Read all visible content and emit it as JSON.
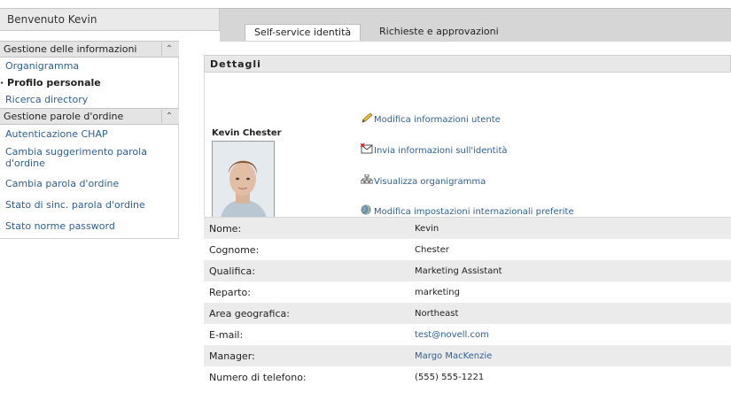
{
  "header": {
    "welcome": "Benvenuto Kevin",
    "tabs": [
      {
        "label": "Self-service identità",
        "active": true
      },
      {
        "label": "Richieste e approvazioni",
        "active": false
      }
    ]
  },
  "sidebar": {
    "groups": [
      {
        "title": "Gestione delle informazioni",
        "items": [
          {
            "label": "Organigramma"
          },
          {
            "label": "Profilo personale",
            "current": true
          },
          {
            "label": "Ricerca directory"
          }
        ]
      },
      {
        "title": "Gestione parole d'ordine",
        "items": [
          {
            "label": "Autenticazione CHAP"
          },
          {
            "label": "Cambia suggerimento parola d'ordine"
          },
          {
            "label": "Cambia parola d'ordine"
          },
          {
            "label": "Stato di sinc. parola d'ordine"
          },
          {
            "label": "Stato norme password"
          }
        ]
      }
    ]
  },
  "details": {
    "title": "Dettagli",
    "user_name": "Kevin Chester",
    "actions": [
      {
        "label": "Modifica informazioni utente",
        "icon": "pencil-icon"
      },
      {
        "label": "Invia informazioni sull'identità",
        "icon": "envelope-icon"
      },
      {
        "label": "Visualizza organigramma",
        "icon": "org-chart-icon"
      },
      {
        "label": "Modifica impostazioni internazionali preferite",
        "icon": "globe-icon"
      }
    ],
    "attributes": [
      {
        "label": "Nome:",
        "value": "Kevin",
        "link": false
      },
      {
        "label": "Cognome:",
        "value": "Chester",
        "link": false
      },
      {
        "label": "Qualifica:",
        "value": "Marketing Assistant",
        "link": false
      },
      {
        "label": "Reparto:",
        "value": "marketing",
        "link": false
      },
      {
        "label": "Area geografica:",
        "value": "Northeast",
        "link": false
      },
      {
        "label": "E-mail:",
        "value": "test@novell.com",
        "link": true
      },
      {
        "label": "Manager:",
        "value": "Margo MacKenzie",
        "link": true
      },
      {
        "label": "Numero di telefono:",
        "value": "(555) 555-1221",
        "link": false
      }
    ]
  },
  "colors": {
    "link": "#2d5f97",
    "row_alt": "#ebebeb",
    "header_bg": "#d6d6d6"
  }
}
